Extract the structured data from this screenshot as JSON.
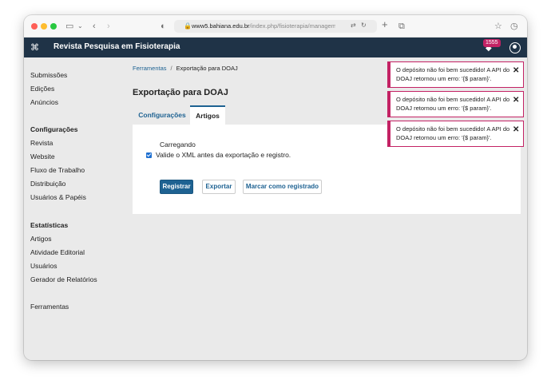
{
  "browser": {
    "url_host": "www5.bahiana.edu.br",
    "url_path": "/index.php/fisioterapia/management/importexport/plugin/DOAJExportPlugin"
  },
  "appbar": {
    "journal_title": "Revista Pesquisa em Fisioterapia",
    "notification_count": "1555"
  },
  "sidebar": {
    "items": [
      "Submissões",
      "Edições",
      "Anúncios"
    ],
    "config_heading": "Configurações",
    "config_items": [
      "Revista",
      "Website",
      "Fluxo de Trabalho",
      "Distribuição",
      "Usuários & Papéis"
    ],
    "stats_heading": "Estatísticas",
    "stats_items": [
      "Artigos",
      "Atividade Editorial",
      "Usuários",
      "Gerador de Relatórios"
    ],
    "tools": "Ferramentas"
  },
  "breadcrumb": {
    "link": "Ferramentas",
    "separator": "/",
    "current": "Exportação para DOAJ"
  },
  "page_title": "Exportação para DOAJ",
  "tabs": [
    "Configurações",
    "Artigos"
  ],
  "panel": {
    "loading": "Carregando",
    "validate_label": "Valide o XML antes da exportação e registro.",
    "buttons": {
      "register": "Registrar",
      "export": "Exportar",
      "mark": "Marcar como registrado"
    }
  },
  "notifications": [
    {
      "message": "O depósito não foi bem sucedido! A API do DOAJ retornou um erro: '{$ param}'."
    },
    {
      "message": "O depósito não foi bem sucedido! A API do DOAJ retornou um erro: '{$ param}'."
    },
    {
      "message": "O depósito não foi bem sucedido! A API do DOAJ retornou um erro: '{$ param}'."
    }
  ],
  "colors": {
    "header_bg": "#1f3347",
    "accent": "#1e6292",
    "error": "#c32264"
  }
}
